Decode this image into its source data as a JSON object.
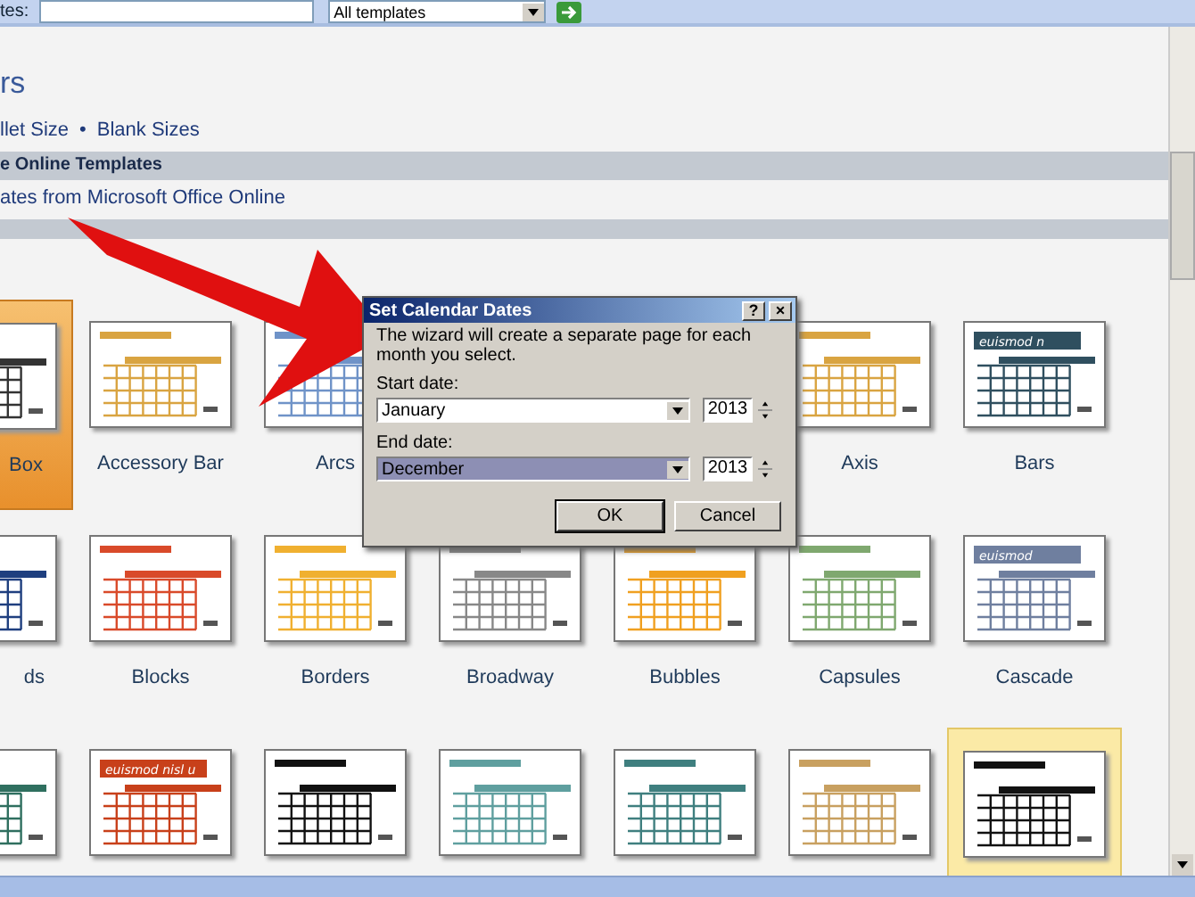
{
  "search_bar": {
    "label": "tes:",
    "dropdown": "All templates"
  },
  "heading": "rs",
  "size_links": {
    "items": [
      "llet Size",
      "Blank Sizes"
    ],
    "separator": "•"
  },
  "online_section": {
    "title": "e Online Templates",
    "link": "ates from Microsoft Office Online"
  },
  "template_rows": [
    [
      {
        "label": "Box",
        "selected": true,
        "highlighted": false,
        "color": "#333333"
      },
      {
        "label": "Accessory Bar",
        "selected": false,
        "highlighted": false,
        "color": "#d9a441"
      },
      {
        "label": "Arcs",
        "selected": false,
        "highlighted": false,
        "color": "#6f93c8"
      },
      {
        "label": "Axis",
        "selected": false,
        "highlighted": false,
        "color": "#d9a441"
      },
      {
        "label": "Bars",
        "title": "euismod n",
        "selected": false,
        "highlighted": false,
        "color": "#2f4f5f"
      }
    ],
    [
      {
        "label": "ds",
        "selected": false,
        "highlighted": false,
        "color": "#1f3f7f"
      },
      {
        "label": "Blocks",
        "selected": false,
        "highlighted": false,
        "color": "#d94a2a"
      },
      {
        "label": "Borders",
        "selected": false,
        "highlighted": false,
        "color": "#f0b030"
      },
      {
        "label": "Broadway",
        "selected": false,
        "highlighted": false,
        "color": "#888888"
      },
      {
        "label": "Bubbles",
        "selected": false,
        "highlighted": false,
        "color": "#f0a020"
      },
      {
        "label": "Capsules",
        "selected": false,
        "highlighted": false,
        "color": "#7fa86f"
      },
      {
        "label": "Cascade",
        "title": "euismod",
        "selected": false,
        "highlighted": false,
        "color": "#6f7f9f"
      }
    ],
    [
      {
        "selected": false,
        "highlighted": false,
        "color": "#2f6f5f"
      },
      {
        "title": "euismod nisl u",
        "selected": false,
        "highlighted": false,
        "color": "#c8401a"
      },
      {
        "selected": false,
        "highlighted": false,
        "color": "#111111"
      },
      {
        "selected": false,
        "highlighted": false,
        "color": "#5f9f9f"
      },
      {
        "selected": false,
        "highlighted": false,
        "color": "#3f7f7f"
      },
      {
        "selected": false,
        "highlighted": false,
        "color": "#c8a060"
      },
      {
        "selected": false,
        "highlighted": true,
        "color": "#111111"
      }
    ]
  ],
  "dialog": {
    "title": "Set Calendar Dates",
    "help": "?",
    "close": "×",
    "message": "The wizard will create a separate page for each month you select.",
    "fields": [
      {
        "label": "Start date:",
        "month": "January",
        "year": "2013",
        "focused": false
      },
      {
        "label": "End date:",
        "month": "December",
        "year": "2013",
        "focused": true
      }
    ],
    "buttons": [
      {
        "label": "OK",
        "default": true
      },
      {
        "label": "Cancel",
        "default": false
      }
    ]
  }
}
